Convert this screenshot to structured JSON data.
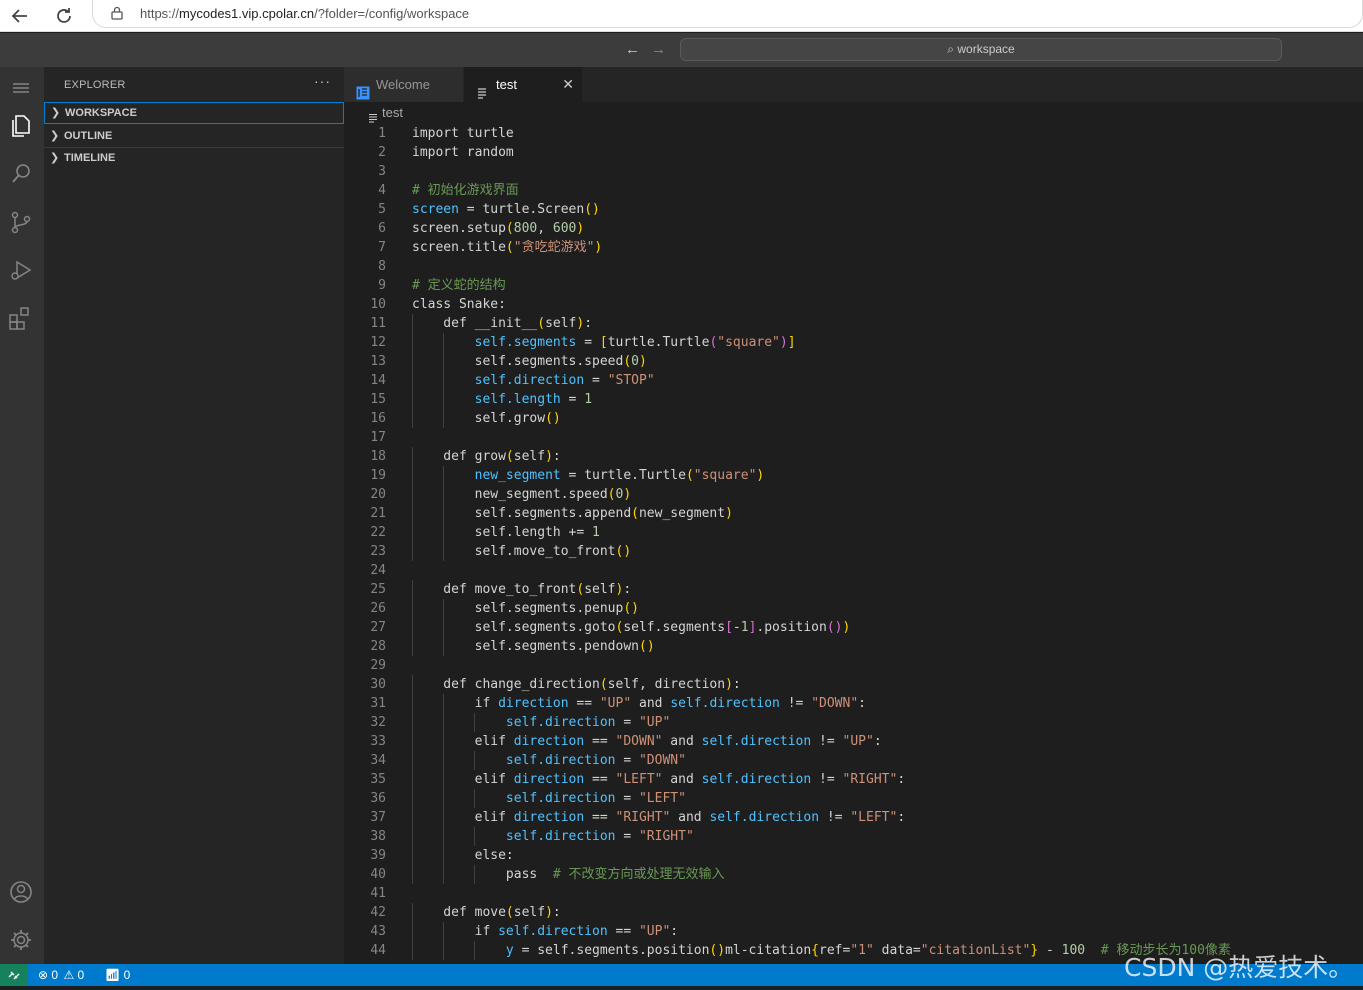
{
  "browser": {
    "url_prefix": "https://",
    "url_host": "mycodes1.vip.cpolar.cn",
    "url_path": "/?folder=/config/workspace"
  },
  "titlebar": {
    "search_text": "workspace"
  },
  "sidebar": {
    "title": "EXPLORER",
    "more": "···",
    "sections": [
      "WORKSPACE",
      "OUTLINE",
      "TIMELINE"
    ]
  },
  "tabs": [
    {
      "label": "Welcome"
    },
    {
      "label": "test"
    }
  ],
  "breadcrumb": "test",
  "status": {
    "errors": "0",
    "warnings": "0",
    "ports": "0"
  },
  "watermark": "CSDN @热爱技术。",
  "code_lines": [
    "import turtle",
    "import random",
    "",
    "# 初始化游戏界面",
    "screen = turtle.Screen()",
    "screen.setup(800, 600)",
    "screen.title(\"贪吃蛇游戏\")",
    "",
    "# 定义蛇的结构",
    "class Snake:",
    "    def __init__(self):",
    "        self.segments = [turtle.Turtle(\"square\")]",
    "        self.segments.speed(0)",
    "        self.direction = \"STOP\"",
    "        self.length = 1",
    "        self.grow()",
    "",
    "    def grow(self):",
    "        new_segment = turtle.Turtle(\"square\")",
    "        new_segment.speed(0)",
    "        self.segments.append(new_segment)",
    "        self.length += 1",
    "        self.move_to_front()",
    "",
    "    def move_to_front(self):",
    "        self.segments.penup()",
    "        self.segments.goto(self.segments[-1].position())",
    "        self.segments.pendown()",
    "",
    "    def change_direction(self, direction):",
    "        if direction == \"UP\" and self.direction != \"DOWN\":",
    "            self.direction = \"UP\"",
    "        elif direction == \"DOWN\" and self.direction != \"UP\":",
    "            self.direction = \"DOWN\"",
    "        elif direction == \"LEFT\" and self.direction != \"RIGHT\":",
    "            self.direction = \"LEFT\"",
    "        elif direction == \"RIGHT\" and self.direction != \"LEFT\":",
    "            self.direction = \"RIGHT\"",
    "        else:",
    "            pass  # 不改变方向或处理无效输入",
    "",
    "    def move(self):",
    "        if self.direction == \"UP\":",
    "            y = self.segments.position()ml-citation{ref=\"1\" data=\"citationList\"} - 100  # 移动步长为100像素"
  ]
}
